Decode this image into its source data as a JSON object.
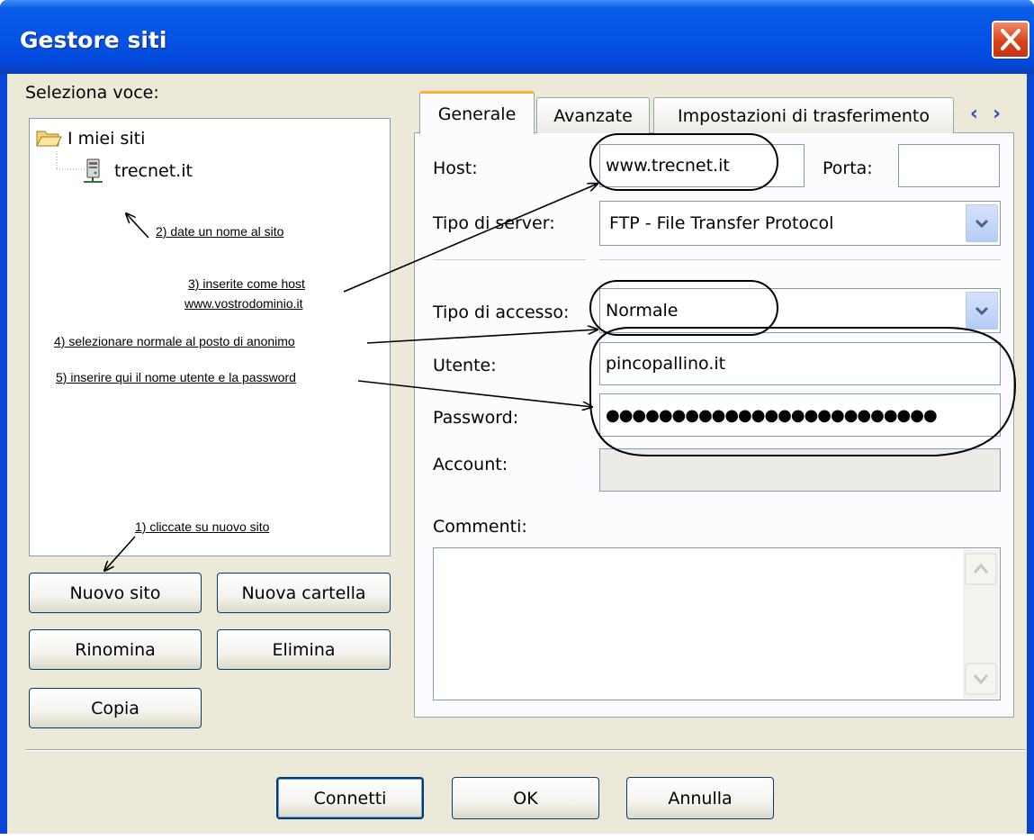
{
  "window": {
    "title": "Gestore siti",
    "close_icon": "close-icon"
  },
  "left": {
    "select_label": "Seleziona voce:",
    "tree": {
      "root": {
        "label": "I miei siti",
        "icon": "folder-open-icon"
      },
      "site": {
        "label": "trecnet.it",
        "icon": "server-icon"
      }
    },
    "buttons": {
      "new_site": "Nuovo sito",
      "new_folder": "Nuova cartella",
      "rename": "Rinomina",
      "delete": "Elimina",
      "copy": "Copia"
    }
  },
  "tabs": {
    "general": "Generale",
    "advanced": "Avanzate",
    "transfer": "Impostazioni di trasferimento",
    "scroll_left": "‹",
    "scroll_right": "›"
  },
  "form": {
    "host_label": "Host:",
    "host_value": "www.trecnet.it",
    "port_label": "Porta:",
    "port_value": "",
    "server_type_label": "Tipo di server:",
    "server_type_value": "FTP - File Transfer Protocol",
    "logon_type_label": "Tipo di accesso:",
    "logon_type_value": "Normale",
    "user_label": "Utente:",
    "user_value": "pincopallino.it",
    "password_label": "Password:",
    "password_value": "●●●●●●●●●●●●●●●●●●●●●●●●●",
    "account_label": "Account:",
    "account_value": "",
    "comments_label": "Commenti:",
    "comments_value": ""
  },
  "footer": {
    "connect": "Connetti",
    "ok": "OK",
    "cancel": "Annulla"
  },
  "annotations": {
    "step1": "1) cliccate su nuovo sito",
    "step2": "2) date un nome al sito",
    "step3_line1": "3) inserite come host",
    "step3_line2": "www.vostrodominio.it",
    "step4": "4) selezionare normale al posto di anonimo",
    "step5": "5) inserire qui il nome utente e la password"
  },
  "colors": {
    "titlebar": "#0553e6",
    "close_button": "#d8431c",
    "dialog_bg": "#ece9d8",
    "active_tab_accent": "#f7b23a"
  }
}
